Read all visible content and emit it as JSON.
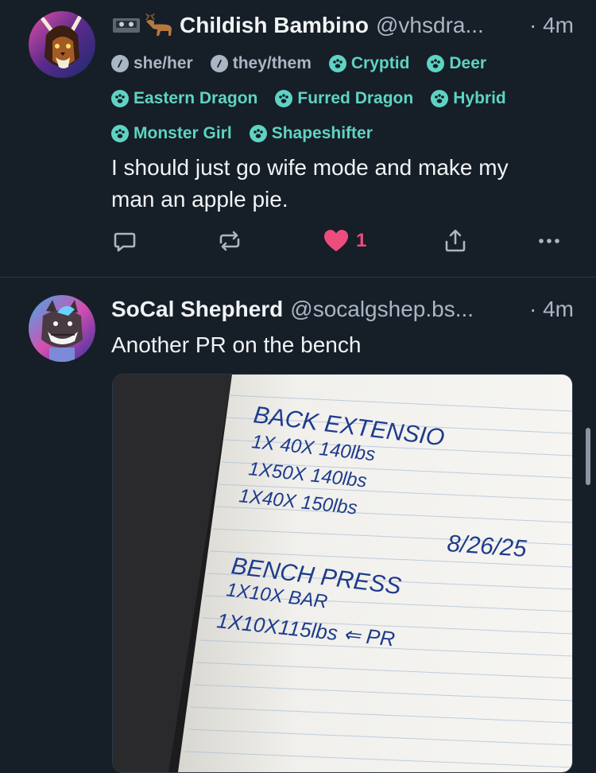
{
  "posts": [
    {
      "author": {
        "emoji": "📼🦌",
        "display_name": "Childish Bambino",
        "handle": "@vhsdra...",
        "time": "· 4m"
      },
      "labels": [
        [
          "she/her",
          "they/them",
          "Cryptid",
          "Deer"
        ],
        [
          "Eastern Dragon",
          "Furred Dragon",
          "Hybrid"
        ],
        [
          "Monster Girl",
          "Shapeshifter"
        ]
      ],
      "text_lines": [
        "I should just go wife mode and make my",
        "man an apple pie."
      ],
      "actions": {
        "like_count": "1"
      }
    },
    {
      "author": {
        "display_name": "SoCal Shepherd",
        "handle": "@socalgshep.bs...",
        "time": "· 4m"
      },
      "text": "Another PR on the bench"
    }
  ],
  "colors": {
    "background": "#161e27",
    "divider": "#2e3a48",
    "teal_label": "#5fd3c3",
    "muted": "#aab6c4",
    "like": "#ec4d7c",
    "ink": "#1d3c8c"
  },
  "image_note": {
    "lines": [
      "BACK EXTENSIO",
      "1X 40X 140lbs",
      "1X50X 140lbs",
      "1X40X 150lbs",
      "8/26/25",
      "BENCH PRESS",
      "1X10X BAR",
      "1X10X115lbs ⇐ PR"
    ]
  }
}
